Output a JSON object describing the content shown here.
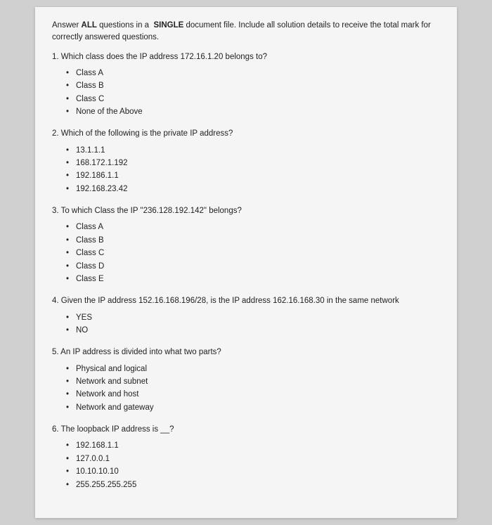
{
  "intro": {
    "line1": "Answer ALL questions in a  SINGLE document file. Include all solution details to receive the total mark for correctly answered",
    "line2": "questions."
  },
  "questions": [
    {
      "id": "q1",
      "text": "1. Which class does the IP address 172.16.1.20 belongs to?",
      "options": [
        "Class A",
        "Class B",
        "Class C",
        "None of the Above"
      ]
    },
    {
      "id": "q2",
      "text": "2. Which of the following is the private IP address?",
      "options": [
        "13.1.1.1",
        "168.172.1.192",
        "192.186.1.1",
        "192.168.23.42"
      ]
    },
    {
      "id": "q3",
      "text": "3. To which Class the IP \"236.128.192.142\" belongs?",
      "options": [
        "Class A",
        "Class B",
        "Class C",
        "Class D",
        "Class E"
      ]
    },
    {
      "id": "q4",
      "text": "4. Given the IP address 152.16.168.196/28, is the IP address 162.16.168.30 in the same network",
      "options": [
        "YES",
        "NO"
      ]
    },
    {
      "id": "q5",
      "text": "5. An IP address is divided into what two parts?",
      "options": [
        "Physical and logical",
        "Network and subnet",
        "Network and host",
        "Network and gateway"
      ]
    },
    {
      "id": "q6",
      "text": "6. The loopback IP address is __?",
      "options": [
        "192.168.1.1",
        "127.0.0.1",
        "10.10.10.10",
        "255.255.255.255"
      ]
    }
  ]
}
